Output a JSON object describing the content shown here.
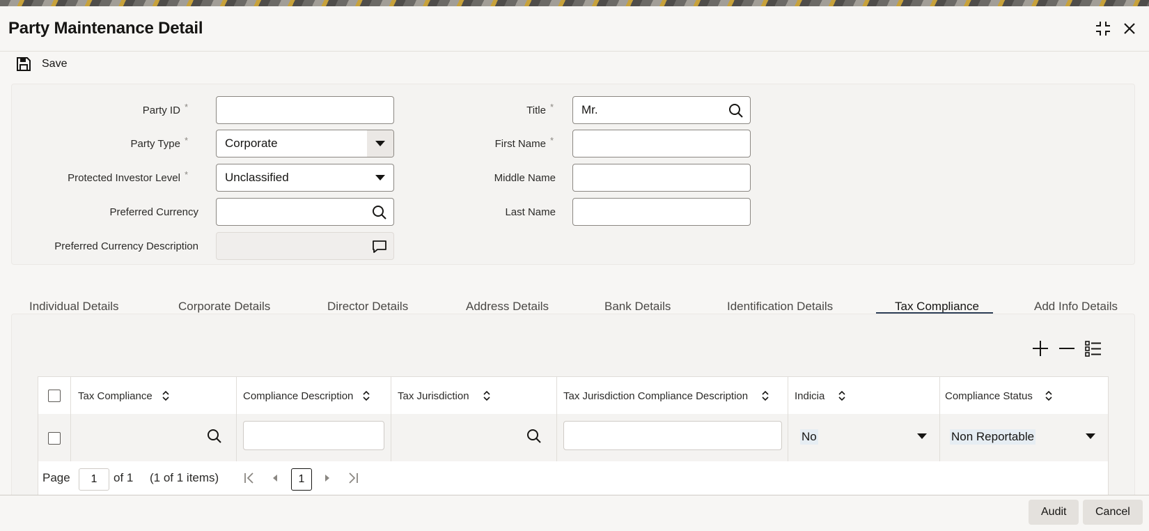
{
  "window": {
    "title": "Party Maintenance Detail",
    "maximize_icon": "maximize-icon",
    "close_icon": "close-icon"
  },
  "toolbar": {
    "save_label": "Save",
    "save_icon": "floppy-disk-icon"
  },
  "form": {
    "party_id": {
      "label": "Party ID",
      "required": "*",
      "value": ""
    },
    "party_type": {
      "label": "Party Type",
      "required": "*",
      "value": "Corporate"
    },
    "protected_investor_level": {
      "label": "Protected Investor Level",
      "required": "*",
      "value": "Unclassified"
    },
    "preferred_currency": {
      "label": "Preferred Currency",
      "value": ""
    },
    "preferred_currency_description": {
      "label": "Preferred Currency Description",
      "value": ""
    },
    "title": {
      "label": "Title",
      "required": "*",
      "value": "Mr."
    },
    "first_name": {
      "label": "First Name",
      "required": "*",
      "value": ""
    },
    "middle_name": {
      "label": "Middle Name",
      "value": ""
    },
    "last_name": {
      "label": "Last Name",
      "value": ""
    }
  },
  "tabs": [
    {
      "label": "Individual Details"
    },
    {
      "label": "Corporate Details"
    },
    {
      "label": "Director Details"
    },
    {
      "label": "Address Details"
    },
    {
      "label": "Bank Details"
    },
    {
      "label": "Identification Details"
    },
    {
      "label": "Tax Compliance",
      "active": true
    },
    {
      "label": "Add Info Details"
    }
  ],
  "grid": {
    "columns": [
      "Tax Compliance",
      "Compliance Description",
      "Tax Jurisdiction",
      "Tax Jurisdiction Compliance Description",
      "Indicia",
      "Compliance Status"
    ],
    "rows": [
      {
        "tax_compliance": "",
        "compliance_description": "",
        "tax_jurisdiction": "",
        "tax_jurisdiction_compliance_description": "",
        "indicia": "No",
        "compliance_status": "Non Reportable"
      }
    ],
    "pagination": {
      "page_label": "Page",
      "page_value": "1",
      "of_label": "of 1",
      "items_label": "(1 of 1 items)",
      "current_page": "1"
    }
  },
  "footer": {
    "audit_label": "Audit",
    "cancel_label": "Cancel"
  },
  "colors": {
    "accent": "#2c3e57",
    "background": "#f7f6f4",
    "panel": "#f4f3f1",
    "selection": "#e6edf3"
  }
}
